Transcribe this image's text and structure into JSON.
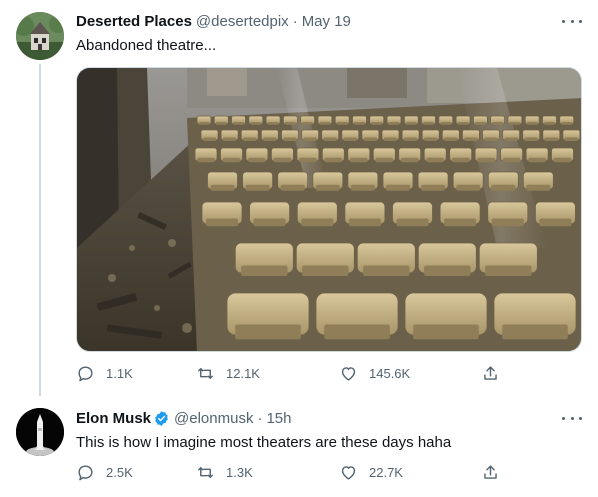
{
  "tweet1": {
    "author_name": "Deserted Places",
    "handle": "@desertedpix",
    "separator": "·",
    "date": "May 19",
    "text": "Abandoned theatre...",
    "replies": "1.1K",
    "retweets": "12.1K",
    "likes": "145.6K"
  },
  "tweet2": {
    "author_name": "Elon Musk",
    "handle": "@elonmusk",
    "separator": "·",
    "date": "15h",
    "text": "This is how I imagine most theaters are these days haha",
    "replies": "2.5K",
    "retweets": "1.3K",
    "likes": "22.7K"
  },
  "colors": {
    "secondary_text": "#536471",
    "verified_blue": "#1d9bf0",
    "thread_line": "#cfd9de"
  },
  "icons": [
    "reply-icon",
    "retweet-icon",
    "like-icon",
    "share-icon",
    "more-icon",
    "verified-badge-icon"
  ]
}
